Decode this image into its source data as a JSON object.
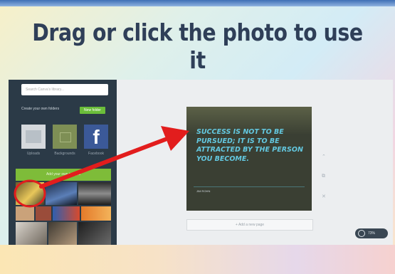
{
  "heading": "Drag or click the photo to use it",
  "sidebar": {
    "search_placeholder": "Search Canva's library...",
    "folder_prompt": "Create your own folders",
    "new_button": "New folder",
    "tiles": [
      {
        "label": "Uploads",
        "icon": "image-icon"
      },
      {
        "label": "Backgrounds",
        "icon": "background-icon"
      },
      {
        "label": "Facebook",
        "icon": "facebook-icon"
      }
    ],
    "photos_bar": "Add your own images"
  },
  "canvas": {
    "quote": "Success is not to be pursued; it is to be attracted by the person you become.",
    "author": "JIM ROHN",
    "add_page": "+ Add a new page",
    "zoom": "73%"
  },
  "colors": {
    "accent_green": "#7ebc39",
    "sidebar_bg": "#2b3a47",
    "quote_text": "#63c8e0",
    "annotation_red": "#e21d1d"
  }
}
